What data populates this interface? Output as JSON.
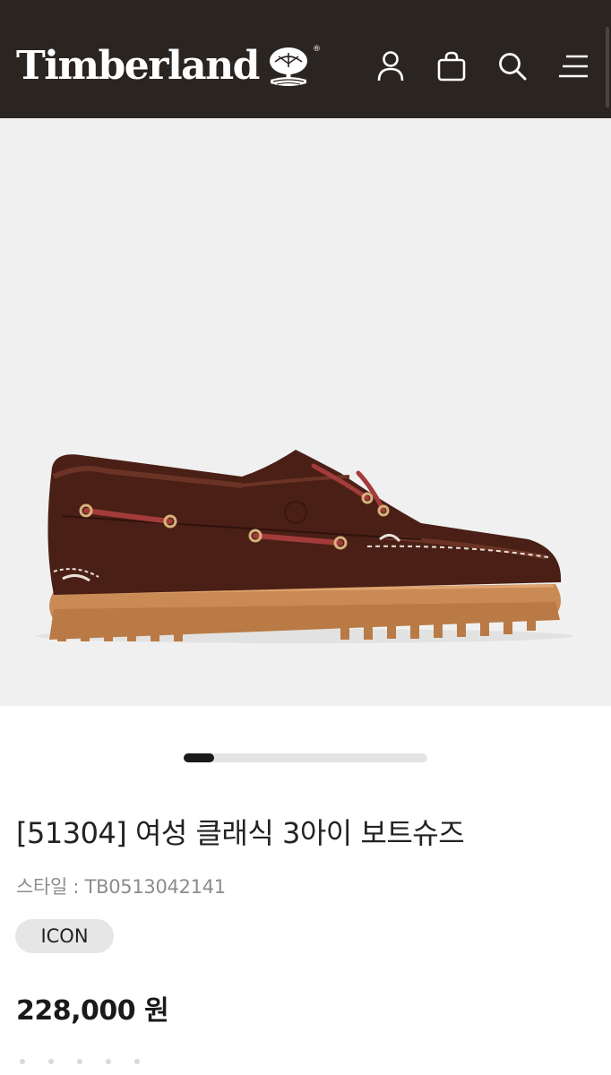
{
  "header": {
    "brand": "Timberland",
    "brand_mark": "®",
    "icons": [
      "user-icon",
      "shopping-bag-icon",
      "search-icon",
      "menu-icon"
    ]
  },
  "carousel": {
    "current": 1,
    "progress": 0.125
  },
  "product": {
    "title": "[51304] 여성 클래식 3아이 보트슈즈",
    "style_line": "스타일 : TB0513042141",
    "badge": "ICON",
    "price": "228,000 원"
  },
  "colors": {
    "header_bg": "#2b2522",
    "image_bg": "#f0f0f0",
    "badge_bg": "#e6e6e6",
    "indicator_active": "#1a1a1a",
    "indicator_track": "#e4e4e4"
  }
}
